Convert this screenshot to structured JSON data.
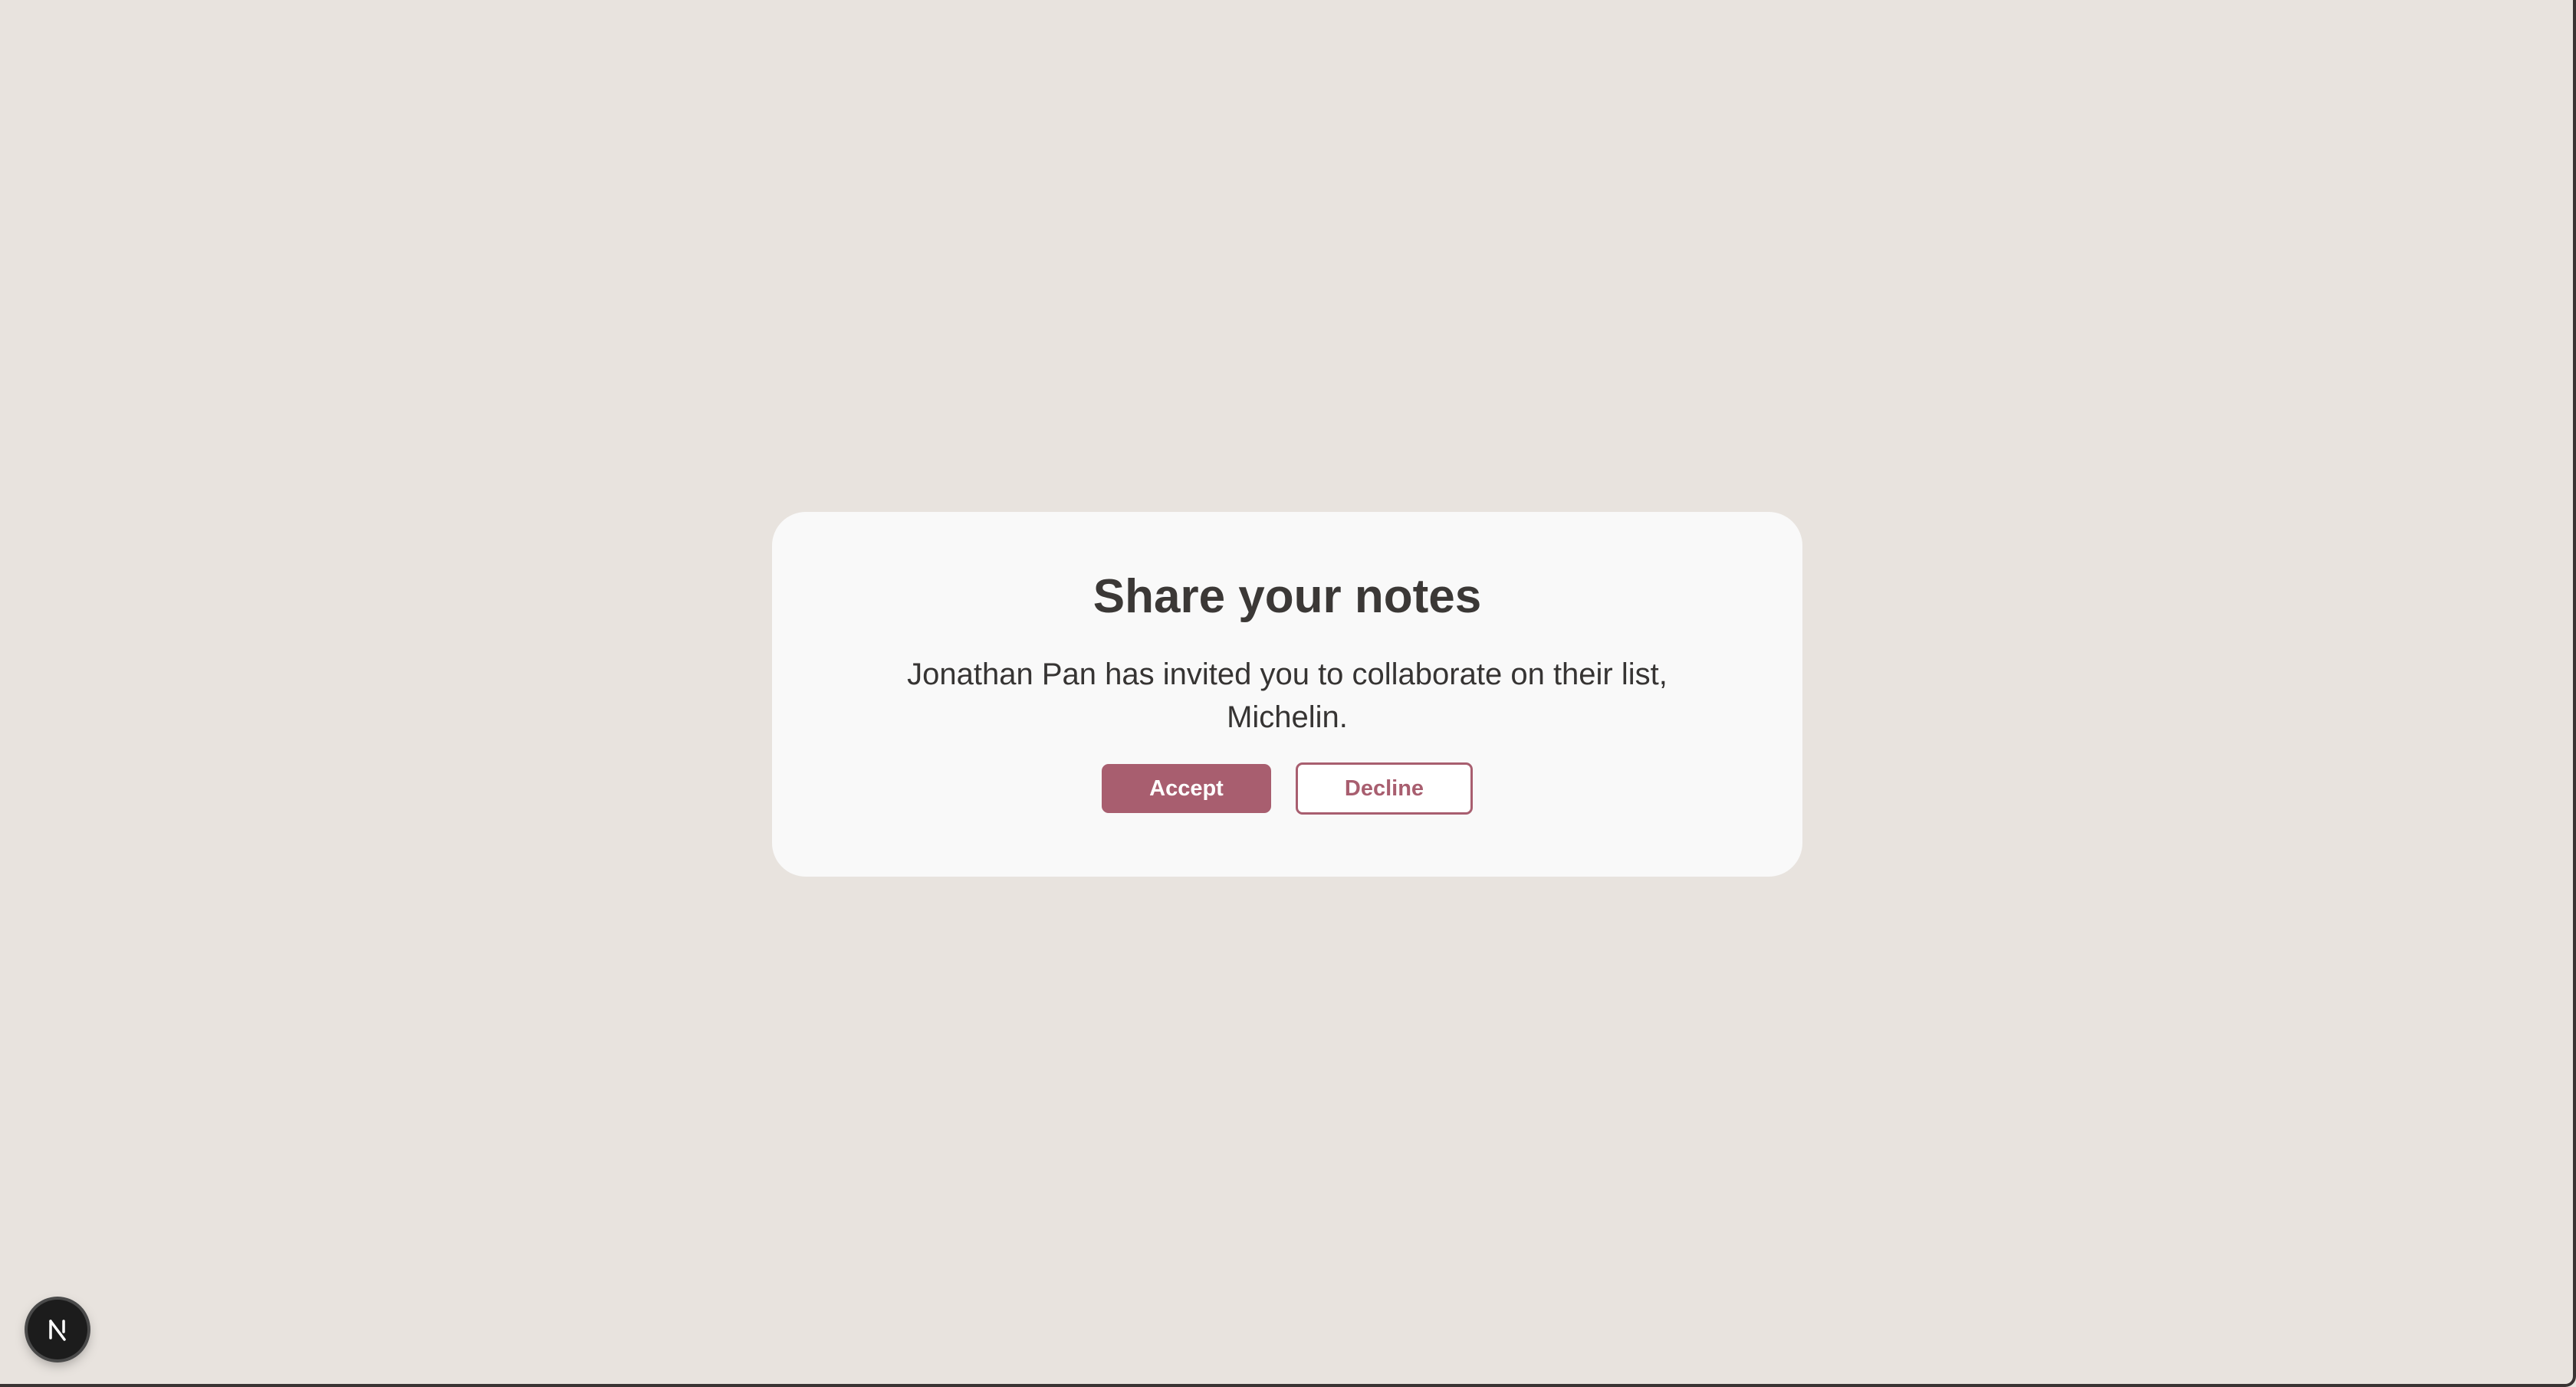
{
  "modal": {
    "title": "Share your notes",
    "message": "Jonathan Pan has invited you to collaborate on their list, Michelin.",
    "accept_label": "Accept",
    "decline_label": "Decline"
  },
  "dev_badge": {
    "icon": "nextjs-logo-icon"
  },
  "colors": {
    "background": "#e8e3de",
    "card": "#f9f9f9",
    "accent": "#a85e6f",
    "text": "#3b3836"
  }
}
